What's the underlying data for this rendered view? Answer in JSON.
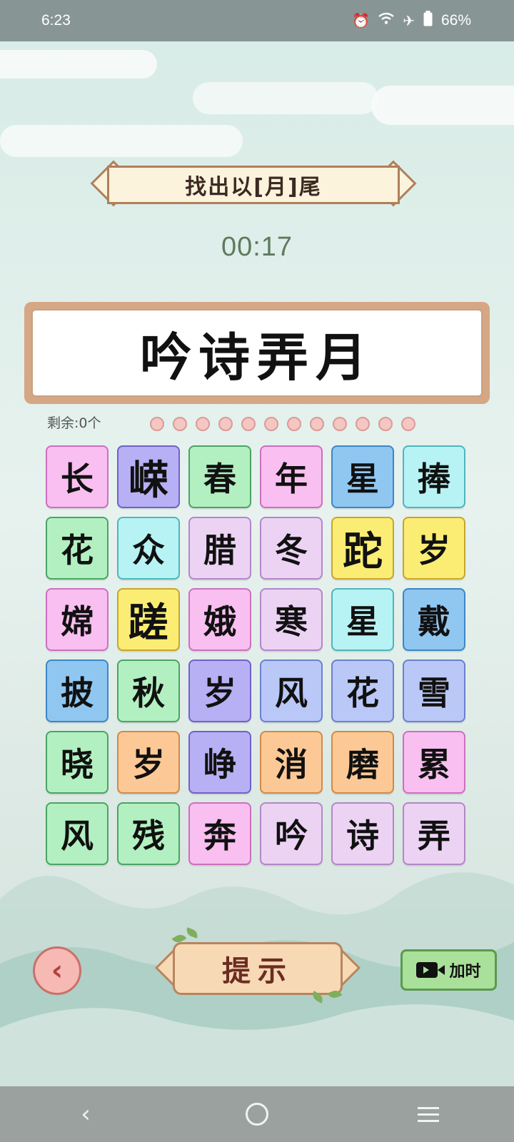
{
  "status_bar": {
    "time": "6:23",
    "battery": "66%",
    "icons": [
      "alarm-icon",
      "wifi-icon",
      "airplane-icon",
      "battery-icon"
    ]
  },
  "game": {
    "title": "找出以[月]尾",
    "timer": "00:17",
    "answer": "吟诗弄月",
    "remaining_label": "剩余:0个",
    "progress_dots": 12,
    "tiles": [
      {
        "char": "长",
        "color": "pink",
        "big": false
      },
      {
        "char": "嵘",
        "color": "purple",
        "big": true
      },
      {
        "char": "春",
        "color": "green",
        "big": false
      },
      {
        "char": "年",
        "color": "pink",
        "big": false
      },
      {
        "char": "星",
        "color": "blue",
        "big": false
      },
      {
        "char": "捧",
        "color": "cyan",
        "big": false
      },
      {
        "char": "花",
        "color": "green",
        "big": false
      },
      {
        "char": "众",
        "color": "cyan",
        "big": false
      },
      {
        "char": "腊",
        "color": "lav",
        "big": false
      },
      {
        "char": "冬",
        "color": "lav",
        "big": false
      },
      {
        "char": "跎",
        "color": "yellow",
        "big": true
      },
      {
        "char": "岁",
        "color": "yellow",
        "big": false
      },
      {
        "char": "嫦",
        "color": "pink",
        "big": false
      },
      {
        "char": "蹉",
        "color": "yellow",
        "big": true
      },
      {
        "char": "娥",
        "color": "pink",
        "big": false
      },
      {
        "char": "寒",
        "color": "lav",
        "big": false
      },
      {
        "char": "星",
        "color": "cyan",
        "big": false
      },
      {
        "char": "戴",
        "color": "blue",
        "big": false
      },
      {
        "char": "披",
        "color": "blue",
        "big": false
      },
      {
        "char": "秋",
        "color": "green",
        "big": false
      },
      {
        "char": "岁",
        "color": "purple",
        "big": false
      },
      {
        "char": "风",
        "color": "peri",
        "big": false
      },
      {
        "char": "花",
        "color": "peri",
        "big": false
      },
      {
        "char": "雪",
        "color": "peri",
        "big": false
      },
      {
        "char": "晓",
        "color": "green",
        "big": false
      },
      {
        "char": "岁",
        "color": "orange",
        "big": false
      },
      {
        "char": "峥",
        "color": "purple",
        "big": false
      },
      {
        "char": "消",
        "color": "orange",
        "big": false
      },
      {
        "char": "磨",
        "color": "orange",
        "big": false
      },
      {
        "char": "累",
        "color": "pink",
        "big": false
      },
      {
        "char": "风",
        "color": "green",
        "big": false
      },
      {
        "char": "残",
        "color": "green",
        "big": false
      },
      {
        "char": "奔",
        "color": "pink",
        "big": false
      },
      {
        "char": "吟",
        "color": "lav",
        "big": false
      },
      {
        "char": "诗",
        "color": "lav",
        "big": false
      },
      {
        "char": "弄",
        "color": "lav",
        "big": false
      }
    ]
  },
  "controls": {
    "back_icon": "back-arrow-icon",
    "hint_label": "提示",
    "add_time_label": "加时",
    "add_time_icon": "video-camera-icon"
  },
  "navbar": {
    "icons": [
      "back-icon",
      "home-icon",
      "recents-icon"
    ]
  }
}
